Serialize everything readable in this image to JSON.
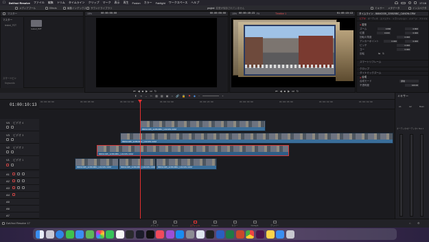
{
  "menubar": {
    "app_name": "DaVinci Resolve",
    "items": [
      "ファイル",
      "編集",
      "トリム",
      "タイムライン",
      "クリップ",
      "マーク",
      "表示",
      "再生",
      "Fusion",
      "カラー",
      "Fairlight",
      "ワークスペース",
      "ヘルプ"
    ],
    "clock": "17:16"
  },
  "toolbar": {
    "media_pool": "メディアプール",
    "effects": "Effects",
    "edit_index": "編集インデックス",
    "sound_library": "サウンドライブラリ",
    "project_title": "project",
    "project_status": "変更が保存されていません",
    "mixer": "ミキサー",
    "metadata": "メタデータ",
    "inspector": "インスペクタ"
  },
  "media_pool": {
    "bin_label": "マスター",
    "tree_master": "マスター",
    "tree_item": "tested_PZT",
    "clip_label": "tested_PZT",
    "smart_bins": "スマートビン",
    "keywords": "Keywords"
  },
  "source_viewer": {
    "zoom": "15%",
    "timecode": "00:00:00:00",
    "duration": "00:00:00:00"
  },
  "timeline_viewer": {
    "zoom": "15%",
    "timecode": "00:00:40:23",
    "fit": "Fit",
    "timeline_name": "Timeline 1",
    "tc_right": "01:00:10:13"
  },
  "inspector": {
    "header": "タイムライン - 8684C035_220520BC_CANON.CRM",
    "tab_video": "ビデオ",
    "tab_audio": "オーディオ",
    "tab_effects": "エフェクト",
    "tab_transition": "トランジション",
    "tab_image": "イメージ",
    "tab_fileinfo": "ファイル",
    "section_transform": "変形",
    "rows": [
      {
        "label": "ズーム",
        "x": "0.800",
        "y": "0.800"
      },
      {
        "label": "位置",
        "x": "0.000",
        "y": "0.000"
      },
      {
        "label": "回転の角度",
        "x": "0.000",
        "y": ""
      },
      {
        "label": "アンカーポイント",
        "x": "0.000",
        "y": "0.000"
      },
      {
        "label": "ピッチ",
        "x": "0.000",
        "y": ""
      },
      {
        "label": "ヨー",
        "x": "0.000",
        "y": ""
      },
      {
        "label": "反転",
        "x": "",
        "y": ""
      }
    ],
    "smart_reframe": "スマートリフレーム",
    "section_crop": "クロップ",
    "section_dynamic_zoom": "ダイナミックズーム",
    "section_composite": "合成",
    "composite_mode_label": "合成モード",
    "composite_mode_value": "通常",
    "opacity_label": "不透明度",
    "opacity_value": "100.00"
  },
  "timeline": {
    "timecode": "01:00:10:13",
    "ruler": [
      "01:00:00:00",
      "01:00:06:00",
      "01:00:12:00",
      "01:00:18:00",
      "01:00:24:00",
      "01:00:30:00",
      "01:00:36:00",
      "01:00:42:00",
      "01:00:48:00"
    ],
    "tracks": [
      {
        "id": "V4",
        "name": "ビデオ 4"
      },
      {
        "id": "V3",
        "name": "ビデオ 3"
      },
      {
        "id": "V2",
        "name": "ビデオ 2"
      },
      {
        "id": "V1",
        "name": "ビデオ 1"
      },
      {
        "id": "A1",
        "name": ""
      },
      {
        "id": "A2",
        "name": ""
      },
      {
        "id": "A3",
        "name": ""
      },
      {
        "id": "A4",
        "name": ""
      },
      {
        "id": "A5",
        "name": ""
      },
      {
        "id": "A6",
        "name": ""
      },
      {
        "id": "A7",
        "name": ""
      }
    ],
    "clips": {
      "v4": "8684C035_220520BC_CANON.CRM",
      "v3": "8684C035_220520BC_CANON.CRM",
      "v2": "8684C035_220520BC_CANON.CRM",
      "v1a": "8684C035_220520BC_CANON.CRM",
      "v1b": "8684C035_220520BC_CANON.CRM",
      "v1c": "8684C035_220520BC_CANON.CRM"
    }
  },
  "mixer": {
    "title": "ミキサー",
    "channels": [
      "A1",
      "A2",
      "Bus1"
    ],
    "sub1": "オーディオ1",
    "sub2": "オーディオ2",
    "sub3": "Bus 1"
  },
  "footer": {
    "app_version": "DaVinci Resolve 17",
    "pages": [
      "メディア",
      "カット",
      "エディット",
      "Fusion",
      "カラー",
      "Fairlight",
      "デリバー"
    ]
  },
  "dock_apps": [
    "finder",
    "launchpad",
    "safari",
    "messages",
    "mail",
    "maps",
    "photos",
    "facetime",
    "calendar",
    "davinci",
    "fcp",
    "tv",
    "music",
    "podcasts",
    "appstore",
    "settings",
    "preview",
    "terminal",
    "word",
    "excel",
    "powerpoint",
    "chrome",
    "slack",
    "notes",
    "downloads",
    "trash"
  ],
  "colors": {
    "clip_blue": "#3a6e9a",
    "selected_border": "#d83a3a",
    "playhead": "#e53030",
    "accent_red": "#e33"
  }
}
